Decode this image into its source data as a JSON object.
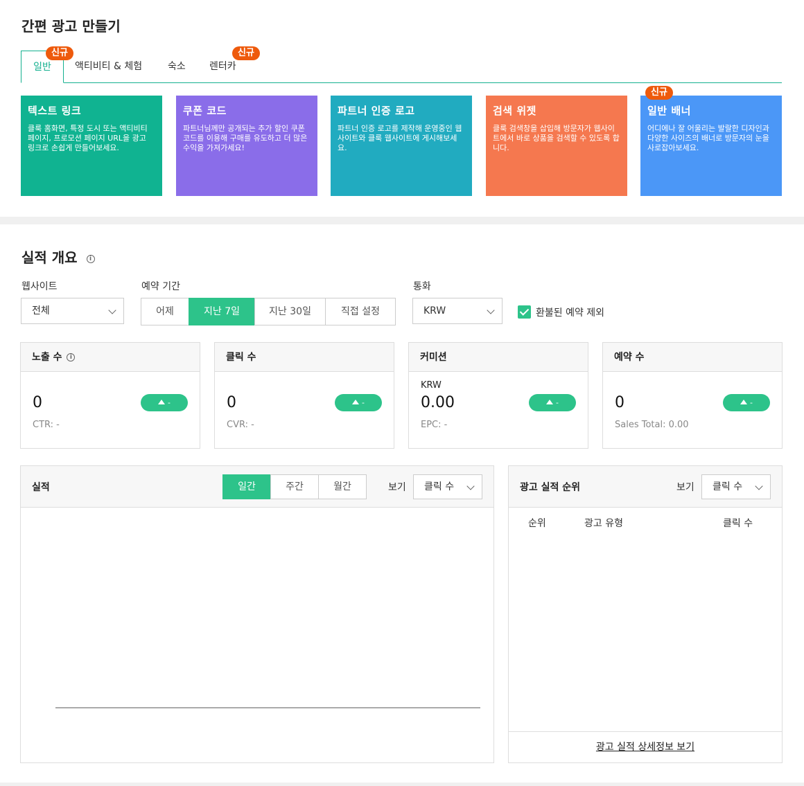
{
  "header": {
    "title": "간편 광고 만들기"
  },
  "tabs": [
    {
      "label": "일반",
      "badge": "신규",
      "active": true
    },
    {
      "label": "액티비티 & 체험"
    },
    {
      "label": "숙소"
    },
    {
      "label": "렌터카",
      "badge": "신규"
    }
  ],
  "ad_cards": [
    {
      "title": "텍스트 링크",
      "desc": "클룩 홈화면, 특정 도시 또는 액티비티 페이지, 프로모션 페이지 URL을 광고 링크로 손쉽게 만들어보세요.",
      "color": "#10b391"
    },
    {
      "title": "쿠폰 코드",
      "desc": "파트너님께만 공개되는 추가 할인 쿠폰 코드를 이용해 구매를 유도하고 더 많은 수익을 가져가세요!",
      "color": "#8a6de9"
    },
    {
      "title": "파트너 인증 로고",
      "desc": "파트너 인증 로고를 제작해 운영중인 웹사이트와 클룩 웹사이트에 게시해보세요.",
      "color": "#21abc0"
    },
    {
      "title": "검색 위젯",
      "desc": "클룩 검색창을 삽입해 방문자가 웹사이트에서 바로 상품을 검색할 수 있도록 합니다.",
      "color": "#f5784f"
    },
    {
      "title": "일반 배너",
      "desc": "어디에나 잘 어울리는 발랄한 디자인과 다양한 사이즈의 배너로 방문자의 눈을 사로잡아보세요.",
      "badge": "신규",
      "color": "#4b97f7"
    }
  ],
  "overview": {
    "title": "실적 개요",
    "filters": {
      "website_label": "웹사이트",
      "website_value": "전체",
      "period_label": "예약 기간",
      "period_options": [
        "어제",
        "지난 7일",
        "지난 30일",
        "직접 설정"
      ],
      "period_selected": "지난 7일",
      "currency_label": "통화",
      "currency_value": "KRW",
      "exclude_refund_label": "환불된 예약 제외",
      "exclude_refund_checked": true
    },
    "stats": [
      {
        "label": "노출 수",
        "value": "0",
        "sub": "CTR: -",
        "trend": "-"
      },
      {
        "label": "클릭 수",
        "value": "0",
        "sub": "CVR: -",
        "trend": "-"
      },
      {
        "label": "커미션",
        "currency": "KRW",
        "value": "0.00",
        "sub": "EPC: -",
        "trend": "-"
      },
      {
        "label": "예약 수",
        "value": "0",
        "sub": "Sales Total: 0.00",
        "trend": "-"
      }
    ]
  },
  "performance": {
    "title": "실적",
    "interval_options": [
      "일간",
      "주간",
      "월간"
    ],
    "interval_selected": "일간",
    "view_label": "보기",
    "view_value": "클릭 수"
  },
  "ranking": {
    "title": "광고 실적 순위",
    "view_label": "보기",
    "view_value": "클릭 수",
    "columns": [
      "순위",
      "광고 유형",
      "클릭 수"
    ],
    "detail_link": "광고 실적 상세정보 보기"
  },
  "colors": {
    "accent": "#2dc38a",
    "tab_accent": "#14b08f",
    "badge": "#ee5a0c"
  }
}
